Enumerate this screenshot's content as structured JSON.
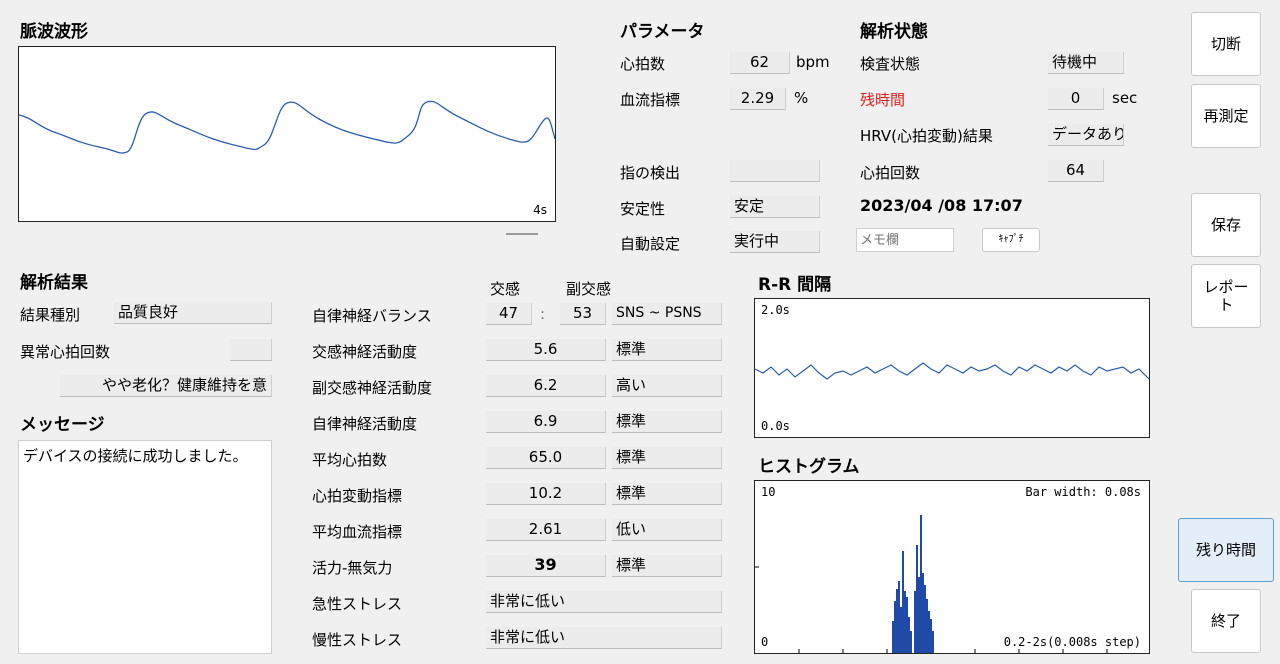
{
  "pulse": {
    "title": "脈波波形",
    "time_label": "4s"
  },
  "params": {
    "title": "パラメータ",
    "heart_rate_label": "心拍数",
    "heart_rate_value": "62",
    "heart_rate_unit": "bpm",
    "blood_flow_label": "血流指標",
    "blood_flow_value": "2.29",
    "blood_flow_unit": "%",
    "finger_label": "指の検出",
    "finger_value": "",
    "stability_label": "安定性",
    "stability_value": "安定",
    "auto_label": "自動設定",
    "auto_value": "実行中"
  },
  "status": {
    "title": "解析状態",
    "exam_label": "検査状態",
    "exam_value": "待機中",
    "remaining_label": "残時間",
    "remaining_value": "0",
    "remaining_unit": "sec",
    "hrv_label": "HRV(心拍変動)結果",
    "hrv_value": "データあり",
    "beats_label": "心拍回数",
    "beats_value": "64",
    "datetime": "2023/04 /08 17:07",
    "memo_placeholder": "メモ欄",
    "capture_label": "ｷｬﾌﾟﾁ"
  },
  "buttons": {
    "disconnect": "切断",
    "remeasure": "再測定",
    "save": "保存",
    "report": "レポート",
    "remaining_time": "残り時間",
    "exit": "終了"
  },
  "result": {
    "title": "解析結果",
    "type_label": "結果種別",
    "type_value": "品質良好",
    "abnormal_label": "異常心拍回数",
    "abnormal_value": "",
    "advice": "やや老化？健康維持を意"
  },
  "message": {
    "title": "メッセージ",
    "text": "デバイスの接続に成功しました。"
  },
  "analysis": {
    "head_sym": "交感",
    "head_para": "副交感",
    "balance_label": "自律神経バランス",
    "balance_sym": "47",
    "balance_sep": ":",
    "balance_para": "53",
    "balance_tag": "SNS ~ PSNS",
    "rows": [
      {
        "label": "交感神経活動度",
        "value": "5.6",
        "rating": "標準"
      },
      {
        "label": "副交感神経活動度",
        "value": "6.2",
        "rating": "高い"
      },
      {
        "label": "自律神経活動度",
        "value": "6.9",
        "rating": "標準"
      },
      {
        "label": "平均心拍数",
        "value": "65.0",
        "rating": "標準"
      },
      {
        "label": "心拍変動指標",
        "value": "10.2",
        "rating": "標準"
      },
      {
        "label": "平均血流指標",
        "value": "2.61",
        "rating": "低い"
      },
      {
        "label": "活力-無気力",
        "value": "39",
        "rating": "標準"
      }
    ],
    "acute_label": "急性ストレス",
    "acute_value": "非常に低い",
    "chronic_label": "慢性ストレス",
    "chronic_value": "非常に低い"
  },
  "rr": {
    "title": "R-R 間隔",
    "top_label": "2.0s",
    "bottom_label": "0.0s"
  },
  "hist": {
    "title": "ヒストグラム",
    "top_label": "10",
    "bottom_label": "0",
    "bar_width_label": "Bar width: 0.08s",
    "range_label": "0.2-2s(0.008s step)"
  },
  "colors": {
    "wave": "#2a5db0",
    "bar": "#1f4aa8",
    "accent": "#e02020"
  }
}
